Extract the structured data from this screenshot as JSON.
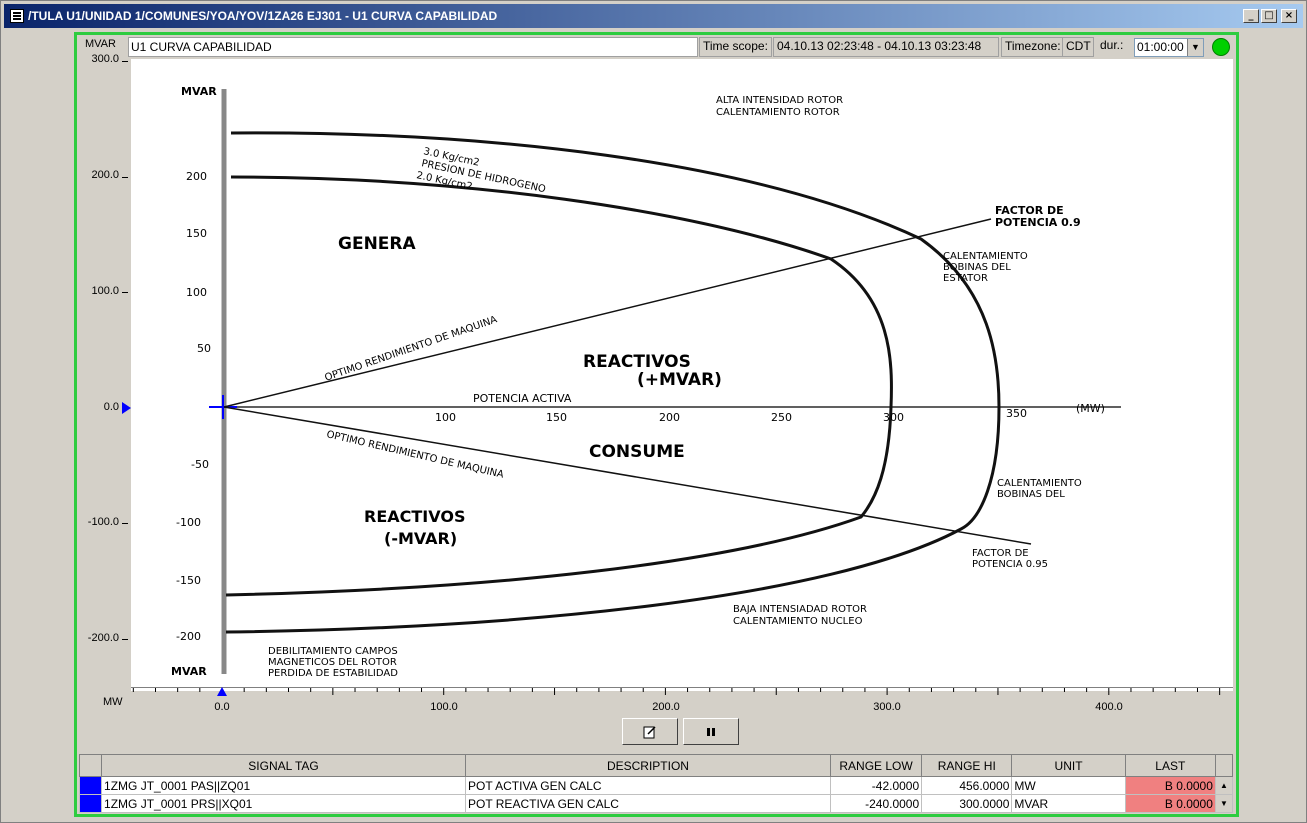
{
  "window": {
    "title": "/TULA U1/UNIDAD 1/COMUNES/YOA/YOV/1ZA26 EJ301 - U1 CURVA CAPABILIDAD",
    "minimize": "_",
    "maximize": "□",
    "close": "×"
  },
  "toolbar": {
    "y_unit": "MVAR",
    "chart_title": "U1 CURVA CAPABILIDAD",
    "time_scope_label": "Time scope:",
    "time_scope_value": "04.10.13 02:23:48 - 04.10.13 03:23:48",
    "timezone_label": "Timezone:",
    "timezone_value": "CDT",
    "dur_label": "dur.:",
    "dur_value": "01:00:00",
    "status_color": "#00d000"
  },
  "axes": {
    "y_unit": "MVAR",
    "x_unit": "MW",
    "y_ticks": [
      "300.0",
      "200.0",
      "100.0",
      "0.0",
      "-100.0",
      "-200.0"
    ],
    "x_ticks": [
      "0.0",
      "100.0",
      "200.0",
      "300.0",
      "400.0"
    ]
  },
  "image_labels": {
    "mvar_top": "MVAR",
    "mvar_bottom": "MVAR",
    "y200": "200",
    "y150": "150",
    "y100": "100",
    "y50": "50",
    "yn50": "-50",
    "yn100": "-100",
    "yn150": "-150",
    "yn200": "-200",
    "x100": "100",
    "x150": "150",
    "x200": "200",
    "x250": "250",
    "x300": "300",
    "x350": "350",
    "mw": "(MW)",
    "potencia_activa": "POTENCIA ACTIVA",
    "genera": "GENERA",
    "consume": "CONSUME",
    "reactivos_pos_1": "REACTIVOS",
    "reactivos_pos_2": "(+MVAR)",
    "reactivos_neg_1": "REACTIVOS",
    "reactivos_neg_2": "(-MVAR)",
    "optimo_top": "OPTIMO RENDIMIENTO DE MAQUINA",
    "optimo_bottom": "OPTIMO RENDIMIENTO DE MAQUINA",
    "alta_1": "ALTA INTENSIDAD ROTOR",
    "alta_2": "CALENTAMIENTO ROTOR",
    "h2_1": "3.0 Kg/cm2",
    "h2_2": "PRESION DE HIDROGENO",
    "h2_3": "2.0 Kg/cm2",
    "fp09_1": "FACTOR DE",
    "fp09_2": "POTENCIA 0.9",
    "cal_est_1": "CALENTAMIENTO",
    "cal_est_2": "BOBINAS DEL",
    "cal_est_3": "ESTATOR",
    "cal_b_1": "CALENTAMIENTO",
    "cal_b_2": "BOBINAS DEL",
    "fp095_1": "FACTOR DE",
    "fp095_2": "POTENCIA 0.95",
    "baja_1": "BAJA INTENSIADAD ROTOR",
    "baja_2": "CALENTAMIENTO NUCLEO",
    "deb_1": "DEBILITAMIENTO CAMPOS",
    "deb_2": "MAGNETICOS DEL ROTOR",
    "deb_3": "PERDIDA DE ESTABILIDAD"
  },
  "buttons": {
    "edit_icon": "edit-icon",
    "pause_icon": "pause-icon"
  },
  "table": {
    "headers": [
      "SIGNAL TAG",
      "DESCRIPTION",
      "RANGE LOW",
      "RANGE HI",
      "UNIT",
      "LAST"
    ],
    "rows": [
      {
        "tag": "1ZMG JT_0001 PAS||ZQ01",
        "description": "POT ACTIVA GEN CALC",
        "range_low": "-42.0000",
        "range_hi": "456.0000",
        "unit": "MW",
        "last": "B 0.0000",
        "color": "#0000ff"
      },
      {
        "tag": "1ZMG JT_0001 PRS||XQ01",
        "description": "POT REACTIVA GEN CALC",
        "range_low": "-240.0000",
        "range_hi": "300.0000",
        "unit": "MVAR",
        "last": "B 0.0000",
        "color": "#0000ff"
      }
    ]
  }
}
